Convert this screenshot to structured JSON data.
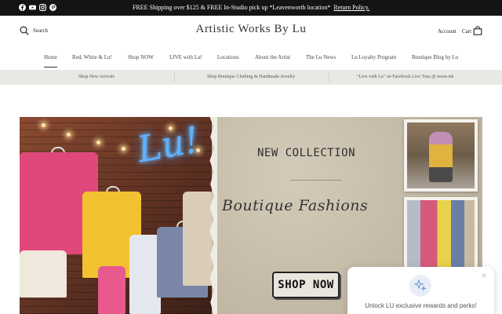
{
  "topbar": {
    "social_icons": [
      "facebook-icon",
      "youtube-icon",
      "instagram-icon",
      "pinterest-icon"
    ],
    "announcement": "FREE Shipping over $125 & FREE In-Studio pick up *Leavenworth location*",
    "policy_link": "Return Policy."
  },
  "header": {
    "search_label": "Search",
    "brand": "Artistic Works By Lu",
    "account_label": "Account",
    "cart_label": "Cart"
  },
  "nav": {
    "items": [
      {
        "label": "Home",
        "active": true
      },
      {
        "label": "Red, White & Lu!"
      },
      {
        "label": "Shop NOW"
      },
      {
        "label": "LIVE with Lu!"
      },
      {
        "label": "Locations"
      },
      {
        "label": "About the Artist"
      },
      {
        "label": "The Lu News"
      },
      {
        "label": "Lu Loyalty Program"
      },
      {
        "label": "Boutique Blog by Lu"
      }
    ]
  },
  "subbar": {
    "items": [
      "Shop New Arrivals",
      "Shop Boutique Clothing & Handmade Jewelry",
      "\"Live with Lu\" on Facebook Live Tues @ noon-ish"
    ]
  },
  "hero": {
    "neon_text": "Lu!",
    "heading": "NEW COLLECTION",
    "script_text": "Boutique Fashions",
    "cta": "SHOP NOW"
  },
  "popup": {
    "message": "Unlock LU exclusive rewards and perks!",
    "close": "×"
  },
  "colors": {
    "topbar_bg": "#141414",
    "subbar_bg": "#e8e8e4",
    "panel_bg": "#c6bcaa"
  }
}
